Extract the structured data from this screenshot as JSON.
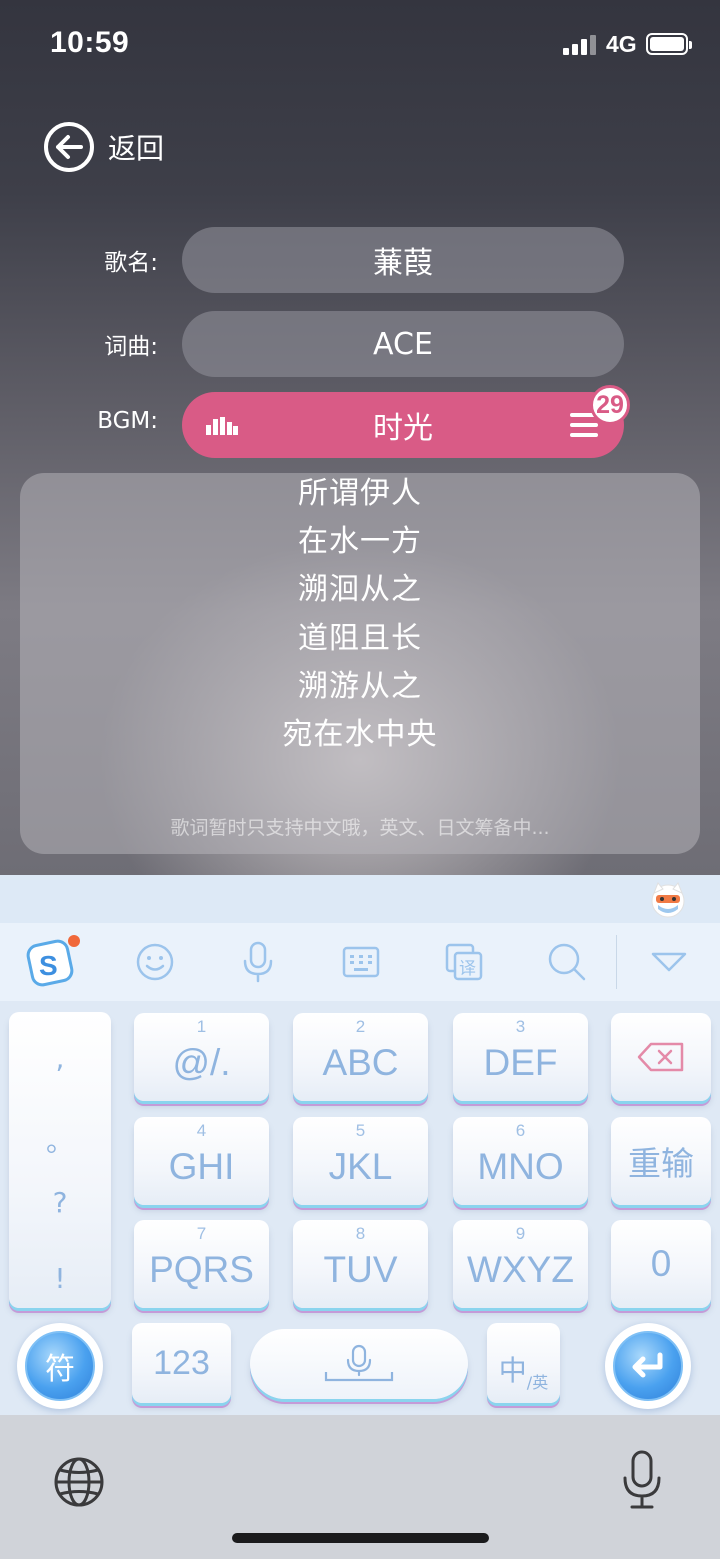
{
  "status_bar": {
    "time": "10:59",
    "network": "4G"
  },
  "header": {
    "back_label": "返回"
  },
  "form": {
    "song_name": {
      "label": "歌名:",
      "value": "蒹葭"
    },
    "lyricist": {
      "label": "词曲:",
      "value": "ACE"
    },
    "bgm": {
      "label": "BGM:",
      "value": "时光",
      "badge_count": "29",
      "accent": "#d95b86"
    }
  },
  "lyrics": {
    "lines": [
      "所谓伊人",
      "在水一方",
      "溯洄从之",
      "道阻且长",
      "溯游从之",
      "宛在水中央"
    ],
    "hint": "歌词暂时只支持中文哦，英文、日文筹备中..."
  },
  "keyboard": {
    "toolbar": [
      "sogou-logo-icon",
      "emoji-icon",
      "voice-icon",
      "keyboard-icon",
      "translate-icon",
      "search-icon",
      "collapse-icon"
    ],
    "punctuation": [
      ",",
      "。",
      "?",
      "!"
    ],
    "keys": {
      "k1": {
        "num": "1",
        "label": "@/."
      },
      "k2": {
        "num": "2",
        "label": "ABC"
      },
      "k3": {
        "num": "3",
        "label": "DEF"
      },
      "k4": {
        "num": "4",
        "label": "GHI"
      },
      "k5": {
        "num": "5",
        "label": "JKL"
      },
      "k6": {
        "num": "6",
        "label": "MNO"
      },
      "k7": {
        "num": "7",
        "label": "PQRS"
      },
      "k8": {
        "num": "8",
        "label": "TUV"
      },
      "k9": {
        "num": "9",
        "label": "WXYZ"
      },
      "retype": "重输",
      "zero": "0",
      "symbols": "符",
      "numbers": "123",
      "lang_main": "中",
      "lang_sub": "/英"
    },
    "accent": "#8fb4df"
  }
}
